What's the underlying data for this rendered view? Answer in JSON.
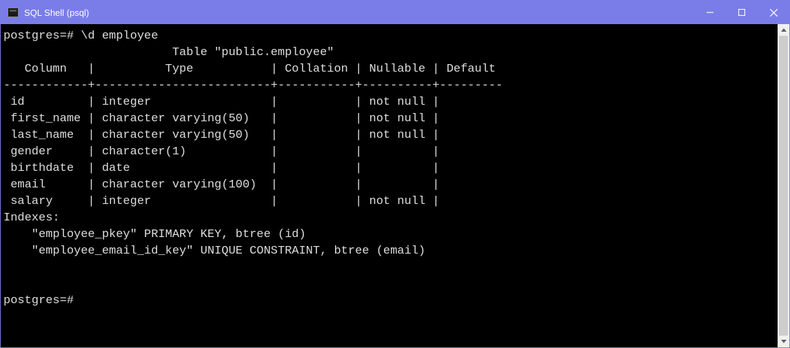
{
  "window": {
    "title": "SQL Shell (psql)"
  },
  "terminal": {
    "prompt": "postgres=#",
    "command": "\\d employee",
    "table_title": "Table \"public.employee\"",
    "headers": {
      "column": "Column",
      "type": "Type",
      "collation": "Collation",
      "nullable": "Nullable",
      "default": "Default"
    },
    "rows": [
      {
        "column": "id",
        "type": "integer",
        "collation": "",
        "nullable": "not null",
        "default": ""
      },
      {
        "column": "first_name",
        "type": "character varying(50)",
        "collation": "",
        "nullable": "not null",
        "default": ""
      },
      {
        "column": "last_name",
        "type": "character varying(50)",
        "collation": "",
        "nullable": "not null",
        "default": ""
      },
      {
        "column": "gender",
        "type": "character(1)",
        "collation": "",
        "nullable": "",
        "default": ""
      },
      {
        "column": "birthdate",
        "type": "date",
        "collation": "",
        "nullable": "",
        "default": ""
      },
      {
        "column": "email",
        "type": "character varying(100)",
        "collation": "",
        "nullable": "",
        "default": ""
      },
      {
        "column": "salary",
        "type": "integer",
        "collation": "",
        "nullable": "not null",
        "default": ""
      }
    ],
    "indexes_label": "Indexes:",
    "indexes": [
      "\"employee_pkey\" PRIMARY KEY, btree (id)",
      "\"employee_email_id_key\" UNIQUE CONSTRAINT, btree (email)"
    ],
    "prompt_final": "postgres=#"
  }
}
